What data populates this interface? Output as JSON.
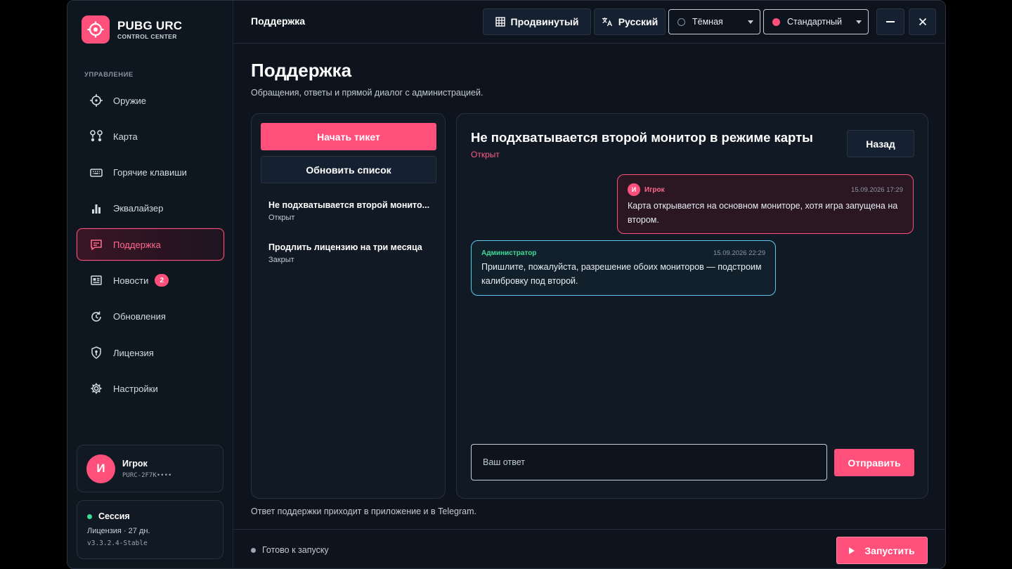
{
  "brand": {
    "title": "PUBG URC",
    "subtitle": "CONTROL CENTER"
  },
  "sidebar": {
    "section_label": "УПРАВЛЕНИЕ",
    "items": [
      {
        "label": "Оружие",
        "icon": "crosshair-icon"
      },
      {
        "label": "Карта",
        "icon": "map-route-icon"
      },
      {
        "label": "Горячие клавиши",
        "icon": "keyboard-icon"
      },
      {
        "label": "Эквалайзер",
        "icon": "bar-chart-icon"
      },
      {
        "label": "Поддержка",
        "icon": "chat-icon",
        "active": true
      },
      {
        "label": "Новости",
        "icon": "newspaper-icon",
        "badge": "2"
      },
      {
        "label": "Обновления",
        "icon": "refresh-icon"
      },
      {
        "label": "Лицензия",
        "icon": "shield-key-icon"
      },
      {
        "label": "Настройки",
        "icon": "gear-icon"
      }
    ],
    "user": {
      "initial": "И",
      "name": "Игрок",
      "key": "PURC-2F7K••••"
    },
    "session": {
      "title": "Сессия",
      "license": "Лицензия · 27 дн.",
      "version": "v3.3.2.4-Stable"
    }
  },
  "topbar": {
    "breadcrumb": "Поддержка",
    "mode_button": "Продвинутый",
    "language_button": "Русский",
    "theme_select": "Тёмная",
    "accent_select": "Стандартный"
  },
  "main": {
    "title": "Поддержка",
    "subtitle": "Обращения, ответы и прямой диалог с администрацией.",
    "footnote": "Ответ поддержки приходит в приложение и в Telegram."
  },
  "tickets": {
    "new_button": "Начать тикет",
    "refresh_button": "Обновить список",
    "list": [
      {
        "title": "Не подхватывается второй монито...",
        "status": "Открыт"
      },
      {
        "title": "Продлить лицензию на три месяца",
        "status": "Закрыт"
      }
    ]
  },
  "chat": {
    "title": "Не подхватывается второй монитор в режиме карты",
    "status": "Открыт",
    "back_button": "Назад",
    "messages": [
      {
        "role": "player",
        "initial": "И",
        "author": "Игрок",
        "time": "15.09.2026 17:29",
        "text": "Карта открывается на основном мониторе, хотя игра запущена на втором."
      },
      {
        "role": "admin",
        "author": "Администратор",
        "time": "15.09.2026 22:29",
        "text": "Пришлите, пожалуйста, разрешение обоих мониторов — подстроим калибровку под второй."
      }
    ],
    "reply_placeholder": "Ваш ответ",
    "send_button": "Отправить"
  },
  "statusbar": {
    "status": "Готово к запуску",
    "launch_button": "Запустить"
  },
  "colors": {
    "accent": "#ff4f7b",
    "admin_border": "#5ec8f0",
    "online": "#3ddc97",
    "background": "#0d141d"
  }
}
